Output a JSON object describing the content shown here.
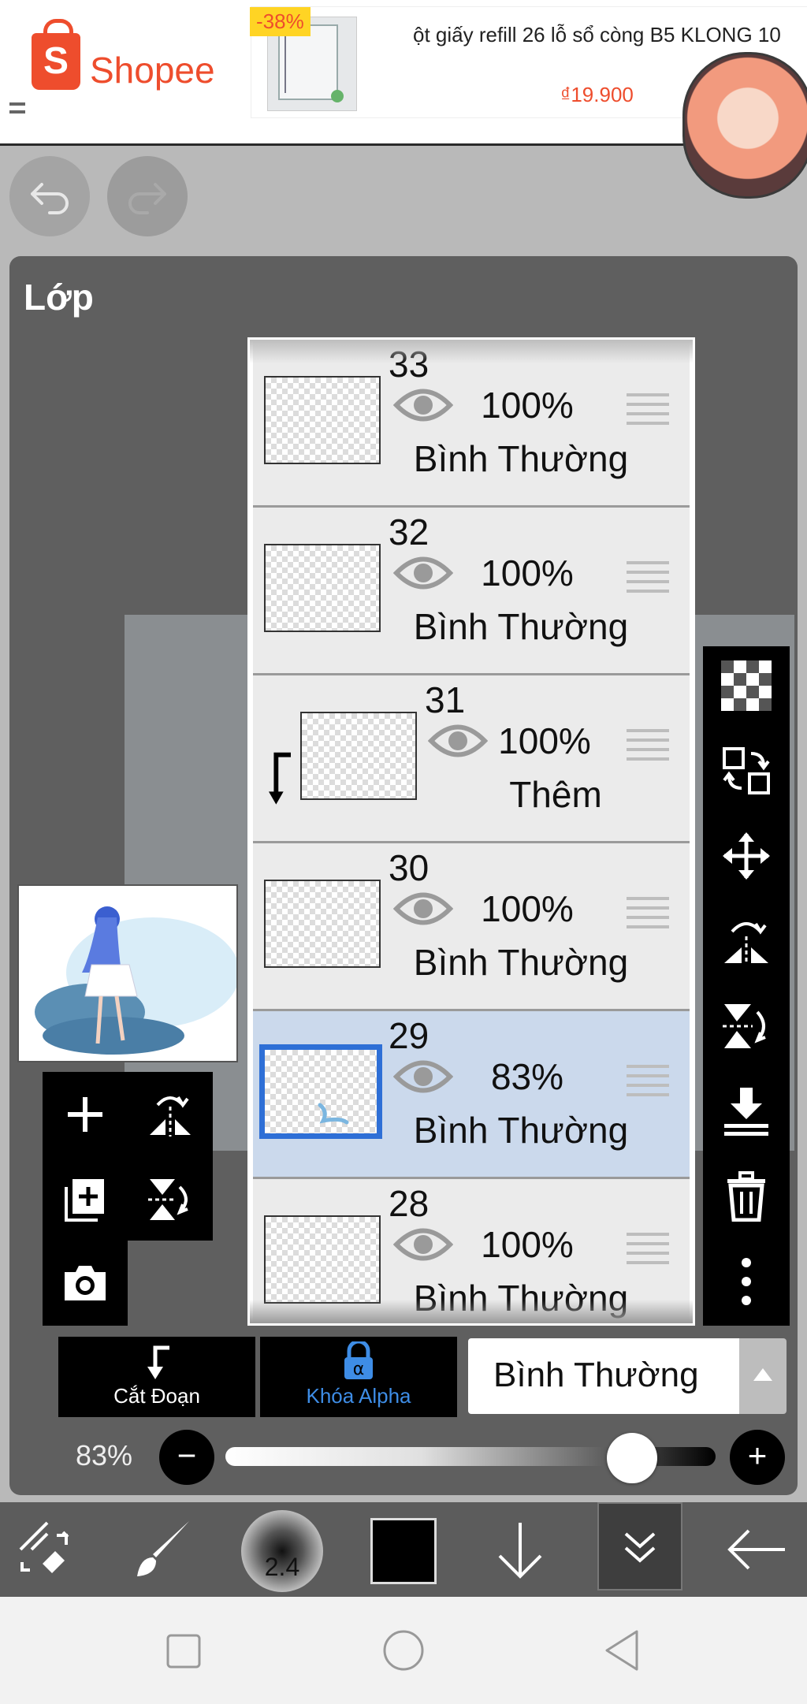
{
  "ad": {
    "brand": "Shopee",
    "discount": "-38%",
    "title": "ột giấy refill 26 lỗ sổ còng B5 KLONG 10",
    "price": "₫19.900"
  },
  "history": {
    "undo_icon": "undo-icon",
    "redo_icon": "redo-icon"
  },
  "panel": {
    "title": "Lớp"
  },
  "layers": [
    {
      "number": "33",
      "opacity": "100%",
      "blend": "Bình Thường",
      "clipped": false,
      "selected": false
    },
    {
      "number": "32",
      "opacity": "100%",
      "blend": "Bình Thường",
      "clipped": false,
      "selected": false
    },
    {
      "number": "31",
      "opacity": "100%",
      "blend": "Thêm",
      "clipped": true,
      "selected": false
    },
    {
      "number": "30",
      "opacity": "100%",
      "blend": "Bình Thường",
      "clipped": false,
      "selected": false
    },
    {
      "number": "29",
      "opacity": "83%",
      "blend": "Bình Thường",
      "clipped": false,
      "selected": true
    },
    {
      "number": "28",
      "opacity": "100%",
      "blend": "Bình Thường",
      "clipped": false,
      "selected": false
    }
  ],
  "right_toolbar": [
    "transparency-icon",
    "swap-layer-icon",
    "move-icon",
    "flip-horizontal-icon",
    "flip-vertical-icon",
    "merge-down-icon",
    "trash-icon",
    "more-icon"
  ],
  "left_toolbar": [
    "add-layer-icon",
    "flip-h-icon",
    "duplicate-layer-icon",
    "flip-v-icon",
    "camera-icon"
  ],
  "actions": {
    "clipping_label": "Cắt Đoạn",
    "alpha_lock_label": "Khóa Alpha",
    "blend_mode": "Bình Thường"
  },
  "opacity": {
    "label": "83%",
    "value": 0.83,
    "minus": "−",
    "plus": "+"
  },
  "bottom_toolbar": {
    "brush_size": "2.4",
    "color": "#000000",
    "items": [
      "transform-icon",
      "brush-icon",
      "brush-size",
      "color-swatch",
      "arrow-down-icon",
      "chevron-double-down-icon",
      "back-arrow-icon"
    ]
  },
  "colors": {
    "selected_row": "#cbd9ec",
    "selected_border": "#2e6fd6",
    "alpha_blue": "#3e8de6",
    "brand": "#ee4d2d"
  }
}
